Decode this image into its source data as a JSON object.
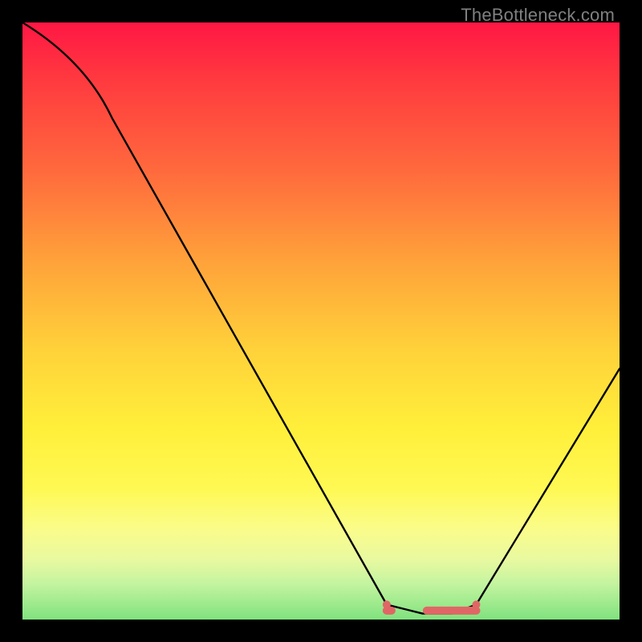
{
  "attribution": "TheBottleneck.com",
  "chart_data": {
    "type": "line",
    "title": "",
    "xlabel": "",
    "ylabel": "",
    "ylim": [
      0,
      100
    ],
    "xlim": [
      0,
      100
    ],
    "series": [
      {
        "name": "curve",
        "x": [
          0,
          15,
          61,
          67,
          72,
          76,
          100
        ],
        "y": [
          100,
          84,
          2.5,
          1,
          1,
          2.5,
          42
        ]
      }
    ],
    "flat_segment": {
      "x_start": 61,
      "x_end": 76,
      "color": "#e06666"
    }
  }
}
